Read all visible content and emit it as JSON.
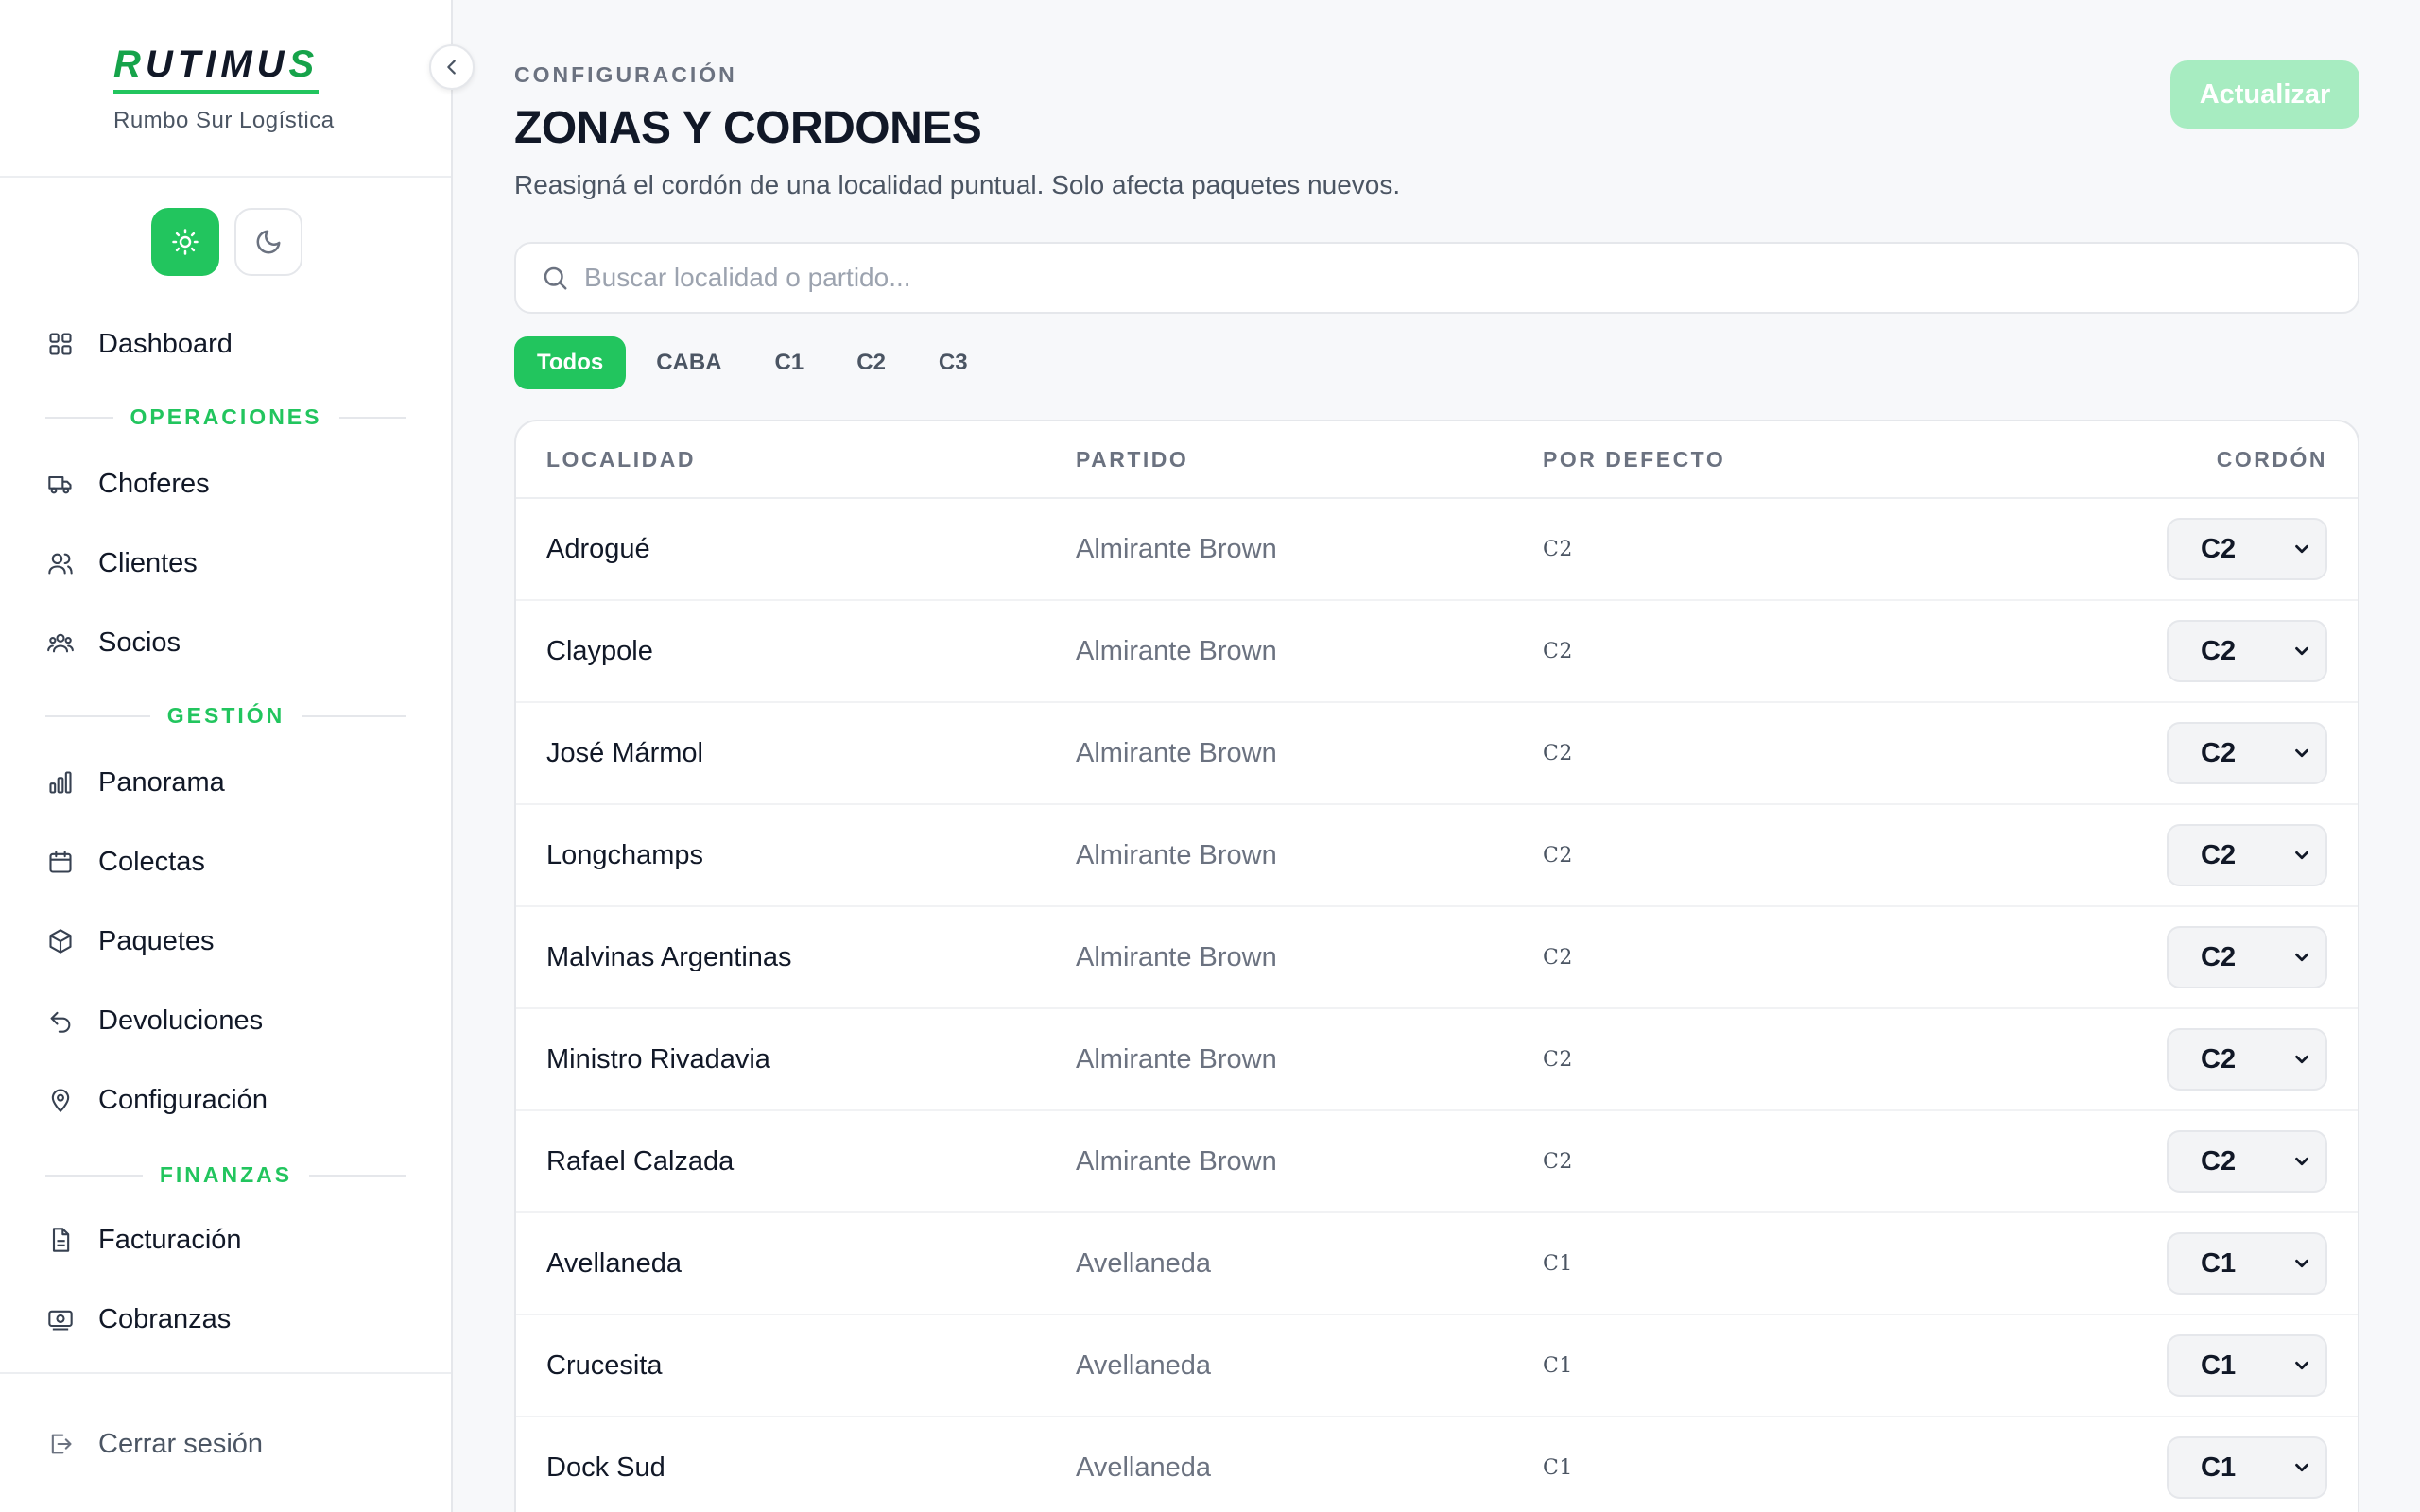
{
  "brand": {
    "logo_r": "R",
    "logo_rest": "UTIMU",
    "logo_s": "S",
    "subtitle": "Rumbo Sur Logística"
  },
  "nav": {
    "dashboard": "Dashboard",
    "section_operaciones": "OPERACIONES",
    "choferes": "Choferes",
    "clientes": "Clientes",
    "socios": "Socios",
    "section_gestion": "GESTIÓN",
    "panorama": "Panorama",
    "colectas": "Colectas",
    "paquetes": "Paquetes",
    "devoluciones": "Devoluciones",
    "configuracion": "Configuración",
    "section_finanzas": "FINANZAS",
    "facturacion": "Facturación",
    "cobranzas": "Cobranzas",
    "logout": "Cerrar sesión"
  },
  "header": {
    "eyebrow": "CONFIGURACIÓN",
    "title": "ZONAS Y CORDONES",
    "description": "Reasigná el cordón de una localidad puntual. Solo afecta paquetes nuevos.",
    "update_button": "Actualizar"
  },
  "search": {
    "placeholder": "Buscar localidad o partido..."
  },
  "filters": [
    "Todos",
    "CABA",
    "C1",
    "C2",
    "C3"
  ],
  "table": {
    "columns": {
      "localidad": "LOCALIDAD",
      "partido": "PARTIDO",
      "por_defecto": "POR DEFECTO",
      "cordon": "CORDÓN"
    },
    "rows": [
      {
        "localidad": "Adrogué",
        "partido": "Almirante Brown",
        "defecto": "C2",
        "cordon": "C2"
      },
      {
        "localidad": "Claypole",
        "partido": "Almirante Brown",
        "defecto": "C2",
        "cordon": "C2"
      },
      {
        "localidad": "José Mármol",
        "partido": "Almirante Brown",
        "defecto": "C2",
        "cordon": "C2"
      },
      {
        "localidad": "Longchamps",
        "partido": "Almirante Brown",
        "defecto": "C2",
        "cordon": "C2"
      },
      {
        "localidad": "Malvinas Argentinas",
        "partido": "Almirante Brown",
        "defecto": "C2",
        "cordon": "C2"
      },
      {
        "localidad": "Ministro Rivadavia",
        "partido": "Almirante Brown",
        "defecto": "C2",
        "cordon": "C2"
      },
      {
        "localidad": "Rafael Calzada",
        "partido": "Almirante Brown",
        "defecto": "C2",
        "cordon": "C2"
      },
      {
        "localidad": "Avellaneda",
        "partido": "Avellaneda",
        "defecto": "C1",
        "cordon": "C1"
      },
      {
        "localidad": "Crucesita",
        "partido": "Avellaneda",
        "defecto": "C1",
        "cordon": "C1"
      },
      {
        "localidad": "Dock Sud",
        "partido": "Avellaneda",
        "defecto": "C1",
        "cordon": "C1"
      }
    ]
  },
  "colors": {
    "accent": "#22c55e",
    "accent_light": "#a7ecc1",
    "text": "#111827",
    "muted": "#6b7280"
  }
}
